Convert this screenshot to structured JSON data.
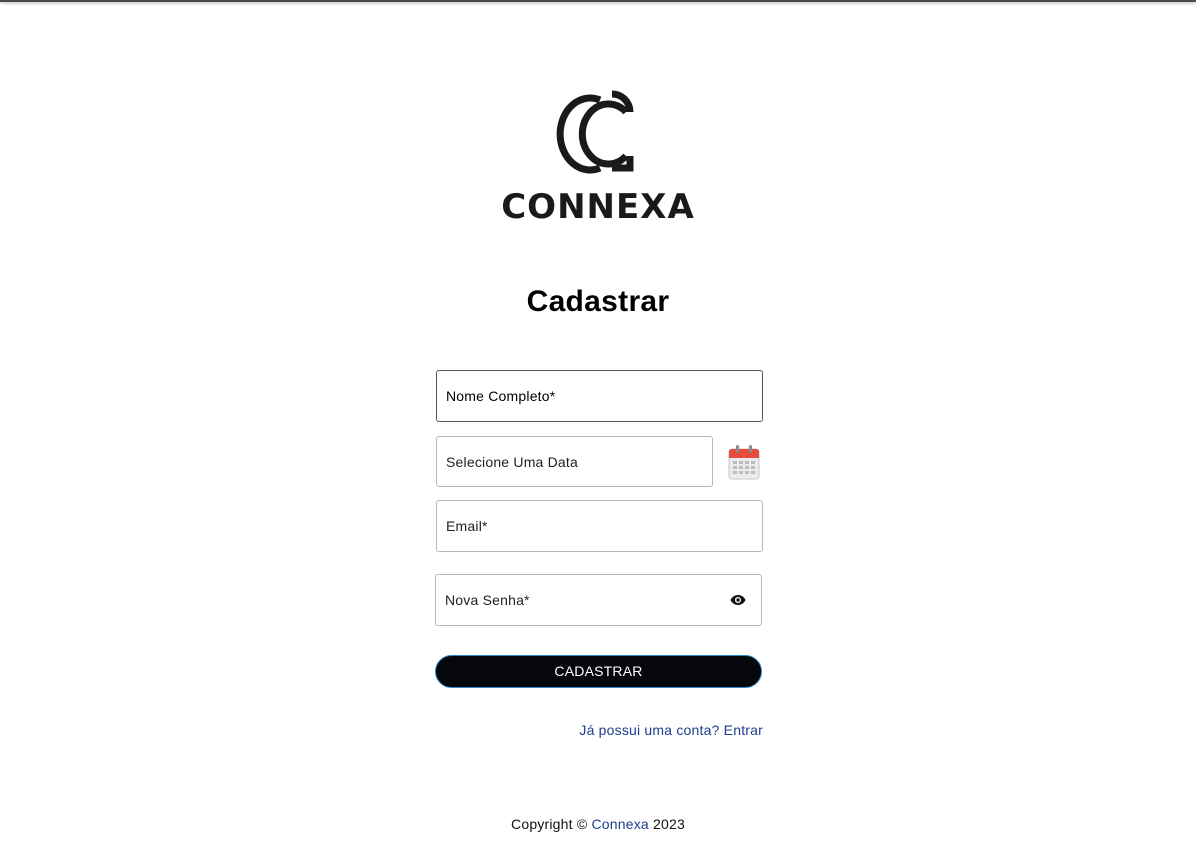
{
  "brand": {
    "name": "CONNEXA",
    "color": "#1a1a1a"
  },
  "form": {
    "title": "Cadastrar",
    "fields": {
      "full_name": {
        "label": "Nome Completo*",
        "value": ""
      },
      "date": {
        "label": "Selecione Uma Data",
        "value": ""
      },
      "email": {
        "label": "Email*",
        "value": ""
      },
      "password": {
        "label": "Nova Senha*",
        "value": ""
      }
    },
    "icons": {
      "calendar": "calendar-icon",
      "visibility": "eye-icon"
    },
    "submit_label": "CADASTRAR",
    "login_link": "Já possui uma conta? Entrar"
  },
  "footer": {
    "prefix": "Copyright © ",
    "link": "Connexa",
    "year": " 2023"
  },
  "colors": {
    "button_bg": "#06070a",
    "button_border": "#2a89c8",
    "link": "#1d3f8c"
  }
}
